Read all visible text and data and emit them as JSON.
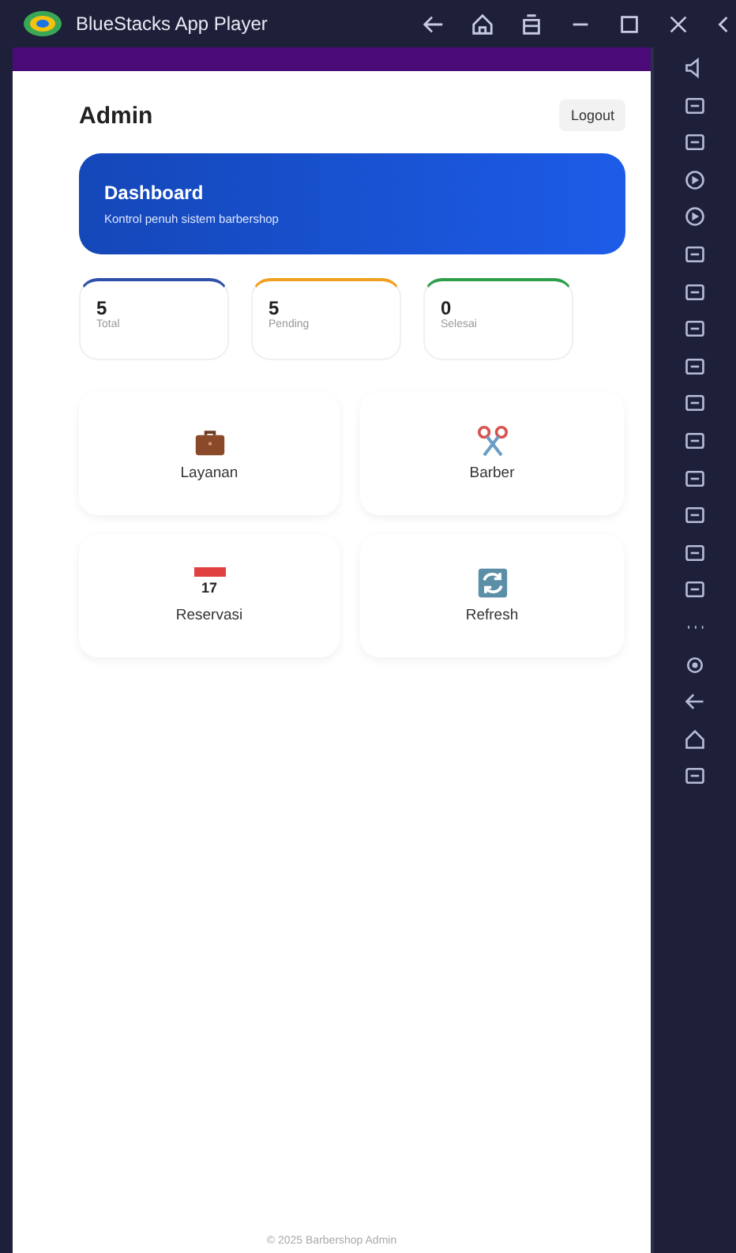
{
  "window": {
    "title": "BlueStacks App Player"
  },
  "app": {
    "title": "Admin",
    "logout": "Logout",
    "banner": {
      "title": "Dashboard",
      "subtitle": "Kontrol penuh sistem barbershop"
    },
    "stats": [
      {
        "value": "5",
        "label": "Total",
        "color": "#2f4fa8"
      },
      {
        "value": "5",
        "label": "Pending",
        "color": "#f0a020"
      },
      {
        "value": "0",
        "label": "Selesai",
        "color": "#2e9e4a"
      }
    ],
    "menu": [
      {
        "label": "Layanan",
        "kind": "briefcase"
      },
      {
        "label": "Barber",
        "kind": "scissors"
      },
      {
        "label": "Reservasi",
        "kind": "calendar",
        "icon_text": "17"
      },
      {
        "label": "Refresh",
        "kind": "refresh"
      }
    ],
    "footer": "© 2025 Barbershop Admin"
  }
}
